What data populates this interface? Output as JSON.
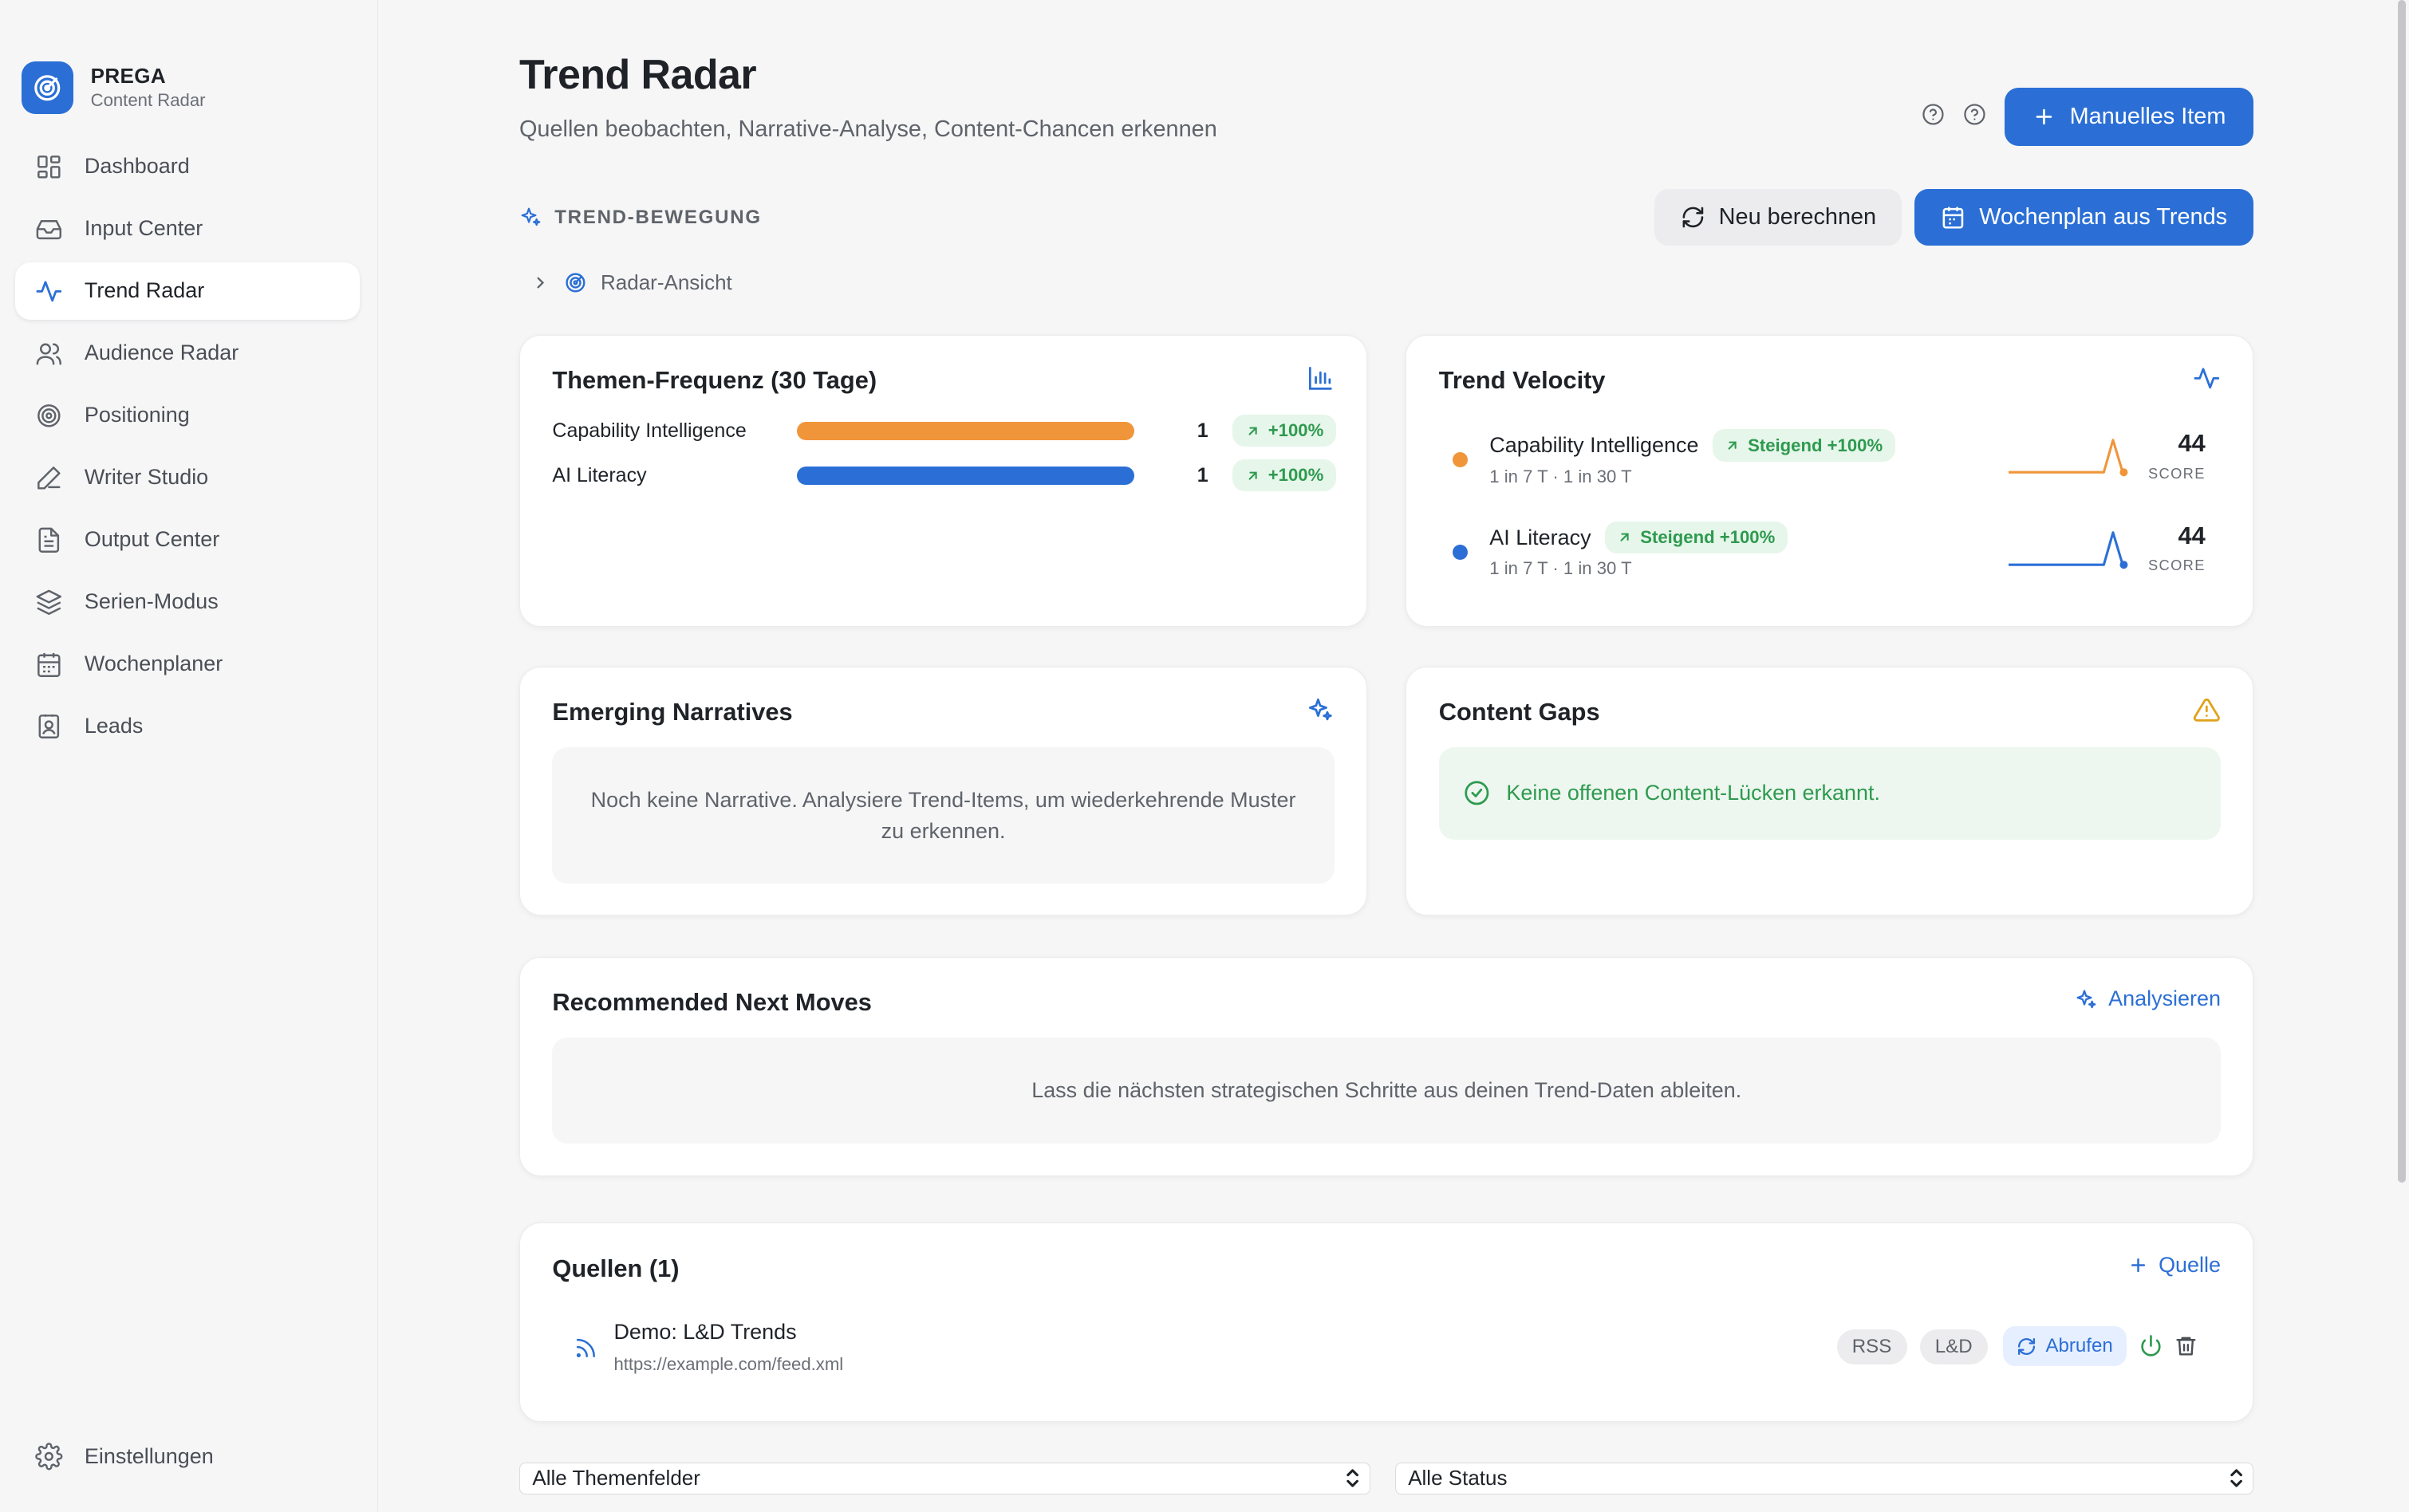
{
  "brand": {
    "name": "PREGA",
    "subtitle": "Content Radar"
  },
  "sidebar": {
    "items": [
      {
        "label": "Dashboard",
        "icon": "grid-icon"
      },
      {
        "label": "Input Center",
        "icon": "inbox-icon"
      },
      {
        "label": "Trend Radar",
        "icon": "activity-icon",
        "active": true
      },
      {
        "label": "Audience Radar",
        "icon": "users-icon"
      },
      {
        "label": "Positioning",
        "icon": "target-icon"
      },
      {
        "label": "Writer Studio",
        "icon": "pen-icon"
      },
      {
        "label": "Output Center",
        "icon": "document-icon"
      },
      {
        "label": "Serien-Modus",
        "icon": "layers-icon"
      },
      {
        "label": "Wochenplaner",
        "icon": "calendar-icon"
      },
      {
        "label": "Leads",
        "icon": "contact-icon"
      }
    ],
    "settings_label": "Einstellungen"
  },
  "header": {
    "title": "Trend Radar",
    "subtitle": "Quellen beobachten, Narrative-Analyse, Content-Chancen erkennen",
    "manual_item_label": "Manuelles Item"
  },
  "toolbar": {
    "section_label": "TREND-BEWEGUNG",
    "recalc_label": "Neu berechnen",
    "weekplan_label": "Wochenplan aus Trends",
    "radar_view_label": "Radar-Ansicht"
  },
  "frequency": {
    "title": "Themen-Frequenz (30 Tage)",
    "rows": [
      {
        "label": "Capability Intelligence",
        "count": "1",
        "change": "+100%",
        "share": 1.0,
        "color": "#f0953a"
      },
      {
        "label": "AI Literacy",
        "count": "1",
        "change": "+100%",
        "share": 1.0,
        "color": "#2b6fd6"
      }
    ]
  },
  "velocity": {
    "title": "Trend Velocity",
    "score_label": "SCORE",
    "rows": [
      {
        "name": "Capability Intelligence",
        "badge": "Steigend +100%",
        "meta": "1 in 7 T · 1 in 30 T",
        "score": "44",
        "color": "#f0953a"
      },
      {
        "name": "AI Literacy",
        "badge": "Steigend +100%",
        "meta": "1 in 7 T · 1 in 30 T",
        "score": "44",
        "color": "#2b6fd6"
      }
    ]
  },
  "narratives": {
    "title": "Emerging Narratives",
    "empty_text": "Noch keine Narrative. Analysiere Trend-Items, um wiederkehrende Muster zu erkennen."
  },
  "gaps": {
    "title": "Content Gaps",
    "ok_text": "Keine offenen Content-Lücken erkannt."
  },
  "next_moves": {
    "title": "Recommended Next Moves",
    "analyze_label": "Analysieren",
    "empty_text": "Lass die nächsten strategischen Schritte aus deinen Trend-Daten ableiten."
  },
  "sources": {
    "title": "Quellen (1)",
    "add_label": "Quelle",
    "items": [
      {
        "name": "Demo: L&D Trends",
        "url": "https://example.com/feed.xml",
        "type": "RSS",
        "topic": "L&D",
        "fetch_label": "Abrufen"
      }
    ]
  },
  "filters": {
    "topic_selected": "Alle Themenfelder",
    "status_selected": "Alle Status"
  },
  "colors": {
    "accent": "#2b6fd6",
    "orange": "#f0953a",
    "green": "#2e9a4f",
    "warning": "#e0a21a"
  }
}
